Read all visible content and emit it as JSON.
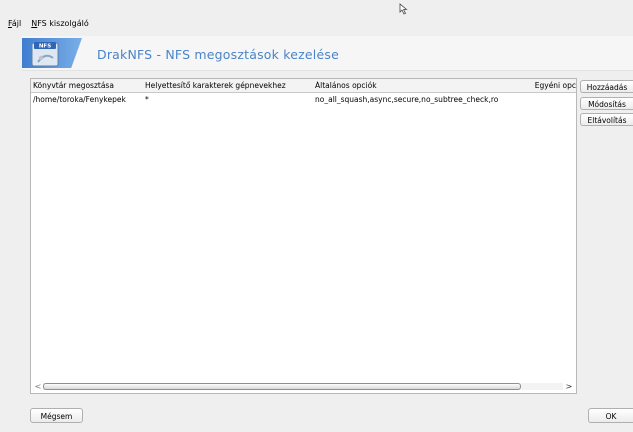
{
  "menu": {
    "file": {
      "accel": "F",
      "rest": "ájl"
    },
    "nfs_server": {
      "accel": "N",
      "rest": "FS kiszolgáló"
    }
  },
  "header": {
    "title": "DrakNFS - NFS megosztások kezelése",
    "badge": "NFS"
  },
  "table": {
    "columns": [
      "Könyvtár megosztása",
      "Helyettesítő karakterek gépnevekhez",
      "Általános opciók",
      "Egyéni opc"
    ],
    "rows": [
      {
        "directory": "/home/toroka/Fenykepek",
        "wildcard": "*",
        "options": "no_all_squash,async,secure,no_subtree_check,ro",
        "custom": ""
      }
    ]
  },
  "side_buttons": {
    "add": "Hozzáadás",
    "edit": "Módosítás",
    "remove": "Eltávolítás"
  },
  "footer": {
    "cancel": "Mégsem",
    "ok": "OK"
  },
  "scroll": {
    "left_arrow": "<",
    "right_arrow": ">"
  }
}
